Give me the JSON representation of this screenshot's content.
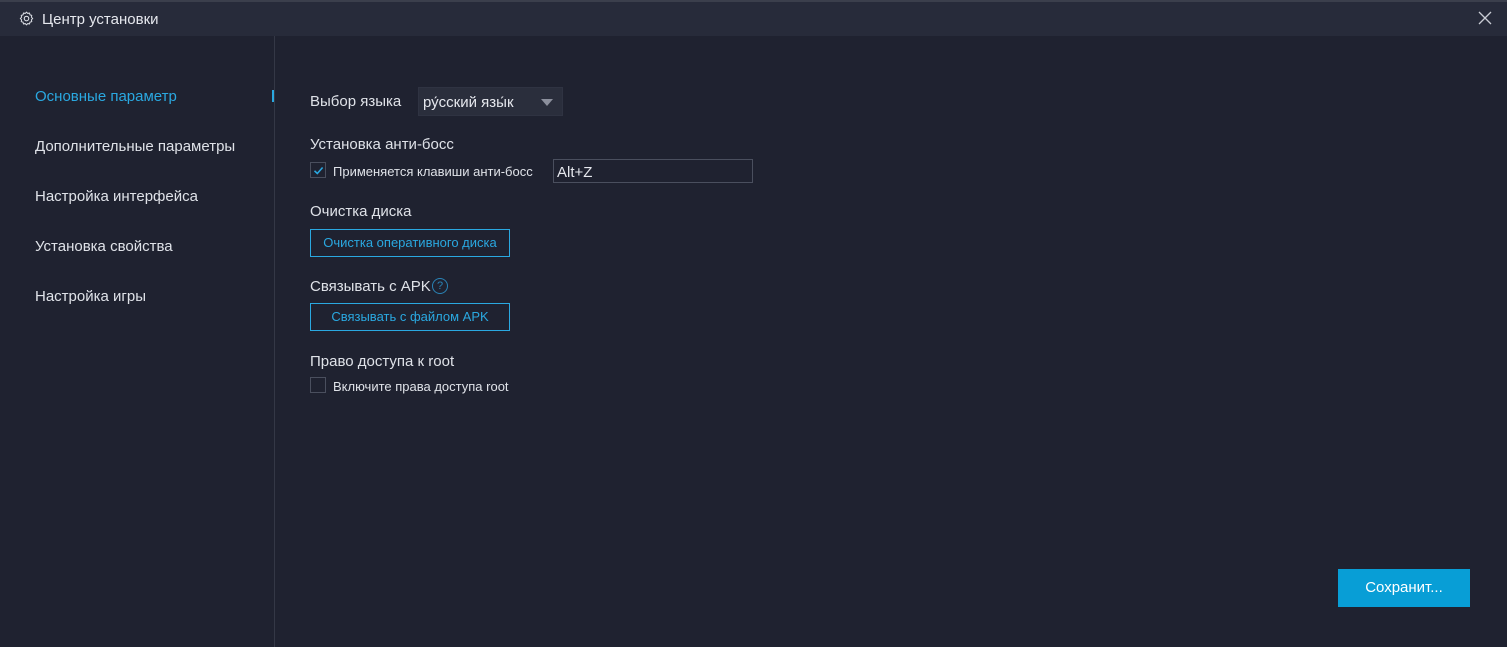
{
  "window": {
    "title": "Центр установки",
    "accent": "#2aa8e0",
    "background": "#1f2230"
  },
  "sidebar": {
    "items": [
      {
        "label": "Основные параметр",
        "active": true
      },
      {
        "label": "Дополнительные параметры",
        "active": false
      },
      {
        "label": "Настройка интерфейса",
        "active": false
      },
      {
        "label": "Установка свойства",
        "active": false
      },
      {
        "label": "Настройка игры",
        "active": false
      }
    ]
  },
  "language": {
    "label": "Выбор языка",
    "selected": "ру́сский язы́к"
  },
  "antiboss": {
    "heading": "Установка анти-босс",
    "checkbox_label": "Применяется клавиши анти-босс",
    "checked": true,
    "hotkey": "Alt+Z"
  },
  "disk": {
    "heading": "Очистка диска",
    "button": "Очистка оперативного диска"
  },
  "apk": {
    "heading": "Связывать с APK",
    "help": "?",
    "button": "Связывать с файлом APK"
  },
  "root": {
    "heading": "Право доступа к root",
    "checkbox_label": "Включите права доступа root",
    "checked": false
  },
  "footer": {
    "save": "Сохранит..."
  },
  "icons": {
    "title": "gear-icon",
    "close": "close-icon",
    "dropdown": "chevron-down-icon",
    "help": "question-icon",
    "check": "checkmark-icon"
  }
}
